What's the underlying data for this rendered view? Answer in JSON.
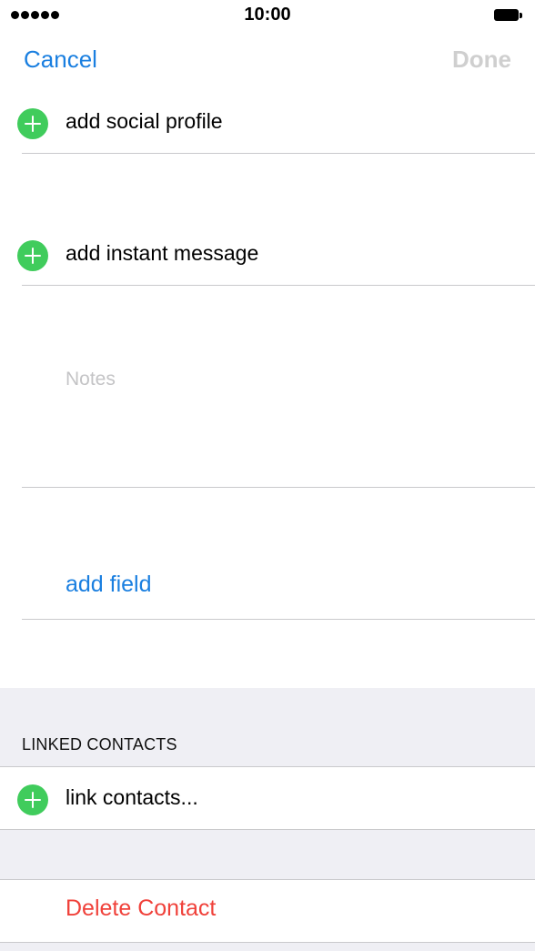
{
  "status_bar": {
    "time": "10:00"
  },
  "nav": {
    "cancel_label": "Cancel",
    "done_label": "Done"
  },
  "rows": {
    "social_profile": "add social profile",
    "instant_message": "add instant message",
    "notes_placeholder": "Notes",
    "add_field": "add field"
  },
  "linked_contacts": {
    "header": "LINKED CONTACTS",
    "link_label": "link contacts..."
  },
  "delete_label": "Delete Contact",
  "colors": {
    "accent": "#1a7fe0",
    "add_green": "#40cc5c",
    "destructive": "#f0413a",
    "group_background": "#efeff4"
  }
}
